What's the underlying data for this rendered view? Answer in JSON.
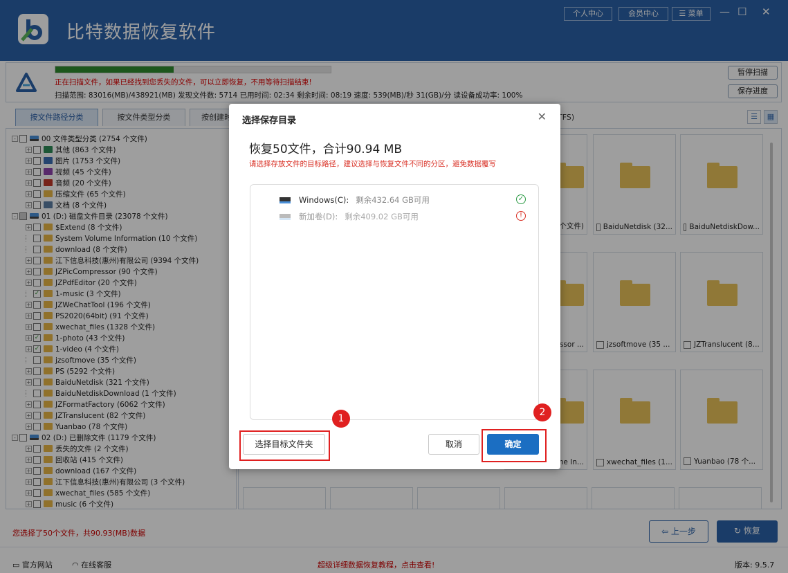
{
  "app": {
    "title": "比特数据恢复软件",
    "personal_center": "个人中心",
    "vip_center": "会员中心",
    "menu": "菜单",
    "minimize": "—",
    "maximize": "☐",
    "close": "✕"
  },
  "scan": {
    "progress": 0.43,
    "message": "正在扫描文件，如果已经找到您丢失的文件，可以立即恢复，不用等待扫描结束!",
    "stats": "扫描范围: 83016(MB)/438921(MB)   发现文件数: 5714   已用时间: 02:34   剩余时间: 08:19   速度: 539(MB)/秒  31(GB)/分   读设备成功率: 100%",
    "pause": "暂停扫描",
    "save_progress": "保存进度"
  },
  "tabs": [
    "按文件路径分类",
    "按文件类型分类",
    "按创建时"
  ],
  "tab_suffix": "TFS)",
  "tree": [
    {
      "t": "00 文件类型分类   (2754 个文件)",
      "ind": 0,
      "exp": "-",
      "icon": "hdd"
    },
    {
      "t": "其他    (863 个文件)",
      "ind": 1,
      "exp": "+",
      "icon": "other"
    },
    {
      "t": "图片    (1753 个文件)",
      "ind": 1,
      "exp": "+",
      "icon": "pic"
    },
    {
      "t": "视频    (45 个文件)",
      "ind": 1,
      "exp": "+",
      "icon": "video"
    },
    {
      "t": "音频    (20 个文件)",
      "ind": 1,
      "exp": "+",
      "icon": "audio"
    },
    {
      "t": "压缩文件   (65 个文件)",
      "ind": 1,
      "exp": "+",
      "icon": "zip"
    },
    {
      "t": "文档    (8 个文件)",
      "ind": 1,
      "exp": "+",
      "icon": "doc"
    },
    {
      "t": "01 (D:) 磁盘文件目录  (23078 个文件)",
      "ind": 0,
      "exp": "-",
      "icon": "hdd",
      "part": true
    },
    {
      "t": "$Extend    (8 个文件)",
      "ind": 1,
      "exp": "+",
      "icon": "folder"
    },
    {
      "t": "System Volume Information    (10 个文件)",
      "ind": 1,
      "exp": "",
      "icon": "folder"
    },
    {
      "t": "download    (8 个文件)",
      "ind": 1,
      "exp": "",
      "icon": "folder"
    },
    {
      "t": "江下信息科技(惠州)有限公司    (9394 个文件)",
      "ind": 1,
      "exp": "+",
      "icon": "folder"
    },
    {
      "t": "JZPicCompressor    (90 个文件)",
      "ind": 1,
      "exp": "+",
      "icon": "folder"
    },
    {
      "t": "JZPdfEditor    (20 个文件)",
      "ind": 1,
      "exp": "+",
      "icon": "folder"
    },
    {
      "t": "1-music    (3 个文件)",
      "ind": 1,
      "exp": "",
      "icon": "folder",
      "checked": true
    },
    {
      "t": "JZWeChatTool    (196 个文件)",
      "ind": 1,
      "exp": "+",
      "icon": "folder"
    },
    {
      "t": "PS2020(64bit)    (91 个文件)",
      "ind": 1,
      "exp": "+",
      "icon": "folder"
    },
    {
      "t": "xwechat_files    (1328 个文件)",
      "ind": 1,
      "exp": "+",
      "icon": "folder"
    },
    {
      "t": "1-photo    (43 个文件)",
      "ind": 1,
      "exp": "+",
      "icon": "folder",
      "checked": true
    },
    {
      "t": "1-video    (4 个文件)",
      "ind": 1,
      "exp": "+",
      "icon": "folder",
      "checked": true
    },
    {
      "t": "jzsoftmove    (35 个文件)",
      "ind": 1,
      "exp": "",
      "icon": "folder"
    },
    {
      "t": "PS    (5292 个文件)",
      "ind": 1,
      "exp": "+",
      "icon": "folder"
    },
    {
      "t": "BaiduNetdisk    (321 个文件)",
      "ind": 1,
      "exp": "+",
      "icon": "folder"
    },
    {
      "t": "BaiduNetdiskDownload    (1 个文件)",
      "ind": 1,
      "exp": "",
      "icon": "folder"
    },
    {
      "t": "JZFormatFactory    (6062 个文件)",
      "ind": 1,
      "exp": "+",
      "icon": "folder"
    },
    {
      "t": "JZTranslucent    (82 个文件)",
      "ind": 1,
      "exp": "+",
      "icon": "folder"
    },
    {
      "t": "Yuanbao    (78 个文件)",
      "ind": 1,
      "exp": "+",
      "icon": "folder"
    },
    {
      "t": "02 (D:) 已删除文件  (1179 个文件)",
      "ind": 0,
      "exp": "-",
      "icon": "hdd"
    },
    {
      "t": "丢失的文件    (2 个文件)",
      "ind": 1,
      "exp": "+",
      "icon": "folder"
    },
    {
      "t": "回收站    (415 个文件)",
      "ind": 1,
      "exp": "+",
      "icon": "folder"
    },
    {
      "t": "download    (167 个文件)",
      "ind": 1,
      "exp": "+",
      "icon": "folder"
    },
    {
      "t": "江下信息科技(惠州)有限公司    (3 个文件)",
      "ind": 1,
      "exp": "+",
      "icon": "folder"
    },
    {
      "t": "xwechat_files    (585 个文件)",
      "ind": 1,
      "exp": "+",
      "icon": "folder"
    },
    {
      "t": "music    (6 个文件)",
      "ind": 1,
      "exp": "+",
      "icon": "folder"
    }
  ],
  "grid": [
    {
      "row": 0,
      "col": 0,
      "label": "个文件)",
      "partial": true
    },
    {
      "row": 0,
      "col": 1,
      "label": "BaiduNetdisk (32..."
    },
    {
      "row": 0,
      "col": 2,
      "label": "BaiduNetdiskDow..."
    },
    {
      "row": 1,
      "col": 0,
      "label": "essor ...",
      "partial": true
    },
    {
      "row": 1,
      "col": 1,
      "label": "jzsoftmove (35 ..."
    },
    {
      "row": 1,
      "col": 2,
      "label": "JZTranslucent (8..."
    },
    {
      "row": 2,
      "col": 0,
      "label": "me In...",
      "partial": true
    },
    {
      "row": 2,
      "col": 1,
      "label": "xwechat_files (1..."
    },
    {
      "row": 2,
      "col": 2,
      "label": "Yuanbao (78 个..."
    }
  ],
  "status": {
    "selected": "您选择了50个文件，共90.93(MB)数据",
    "prev": "上一步",
    "recover": "恢复"
  },
  "footer": {
    "website": "官方网站",
    "service": "在线客服",
    "tutorial": "超级详细数据恢复教程，点击查看!",
    "version": "版本: 9.5.7"
  },
  "dialog": {
    "title": "选择保存目录",
    "headline": "恢复50文件，合计90.94 MB",
    "hint": "请选择存放文件的目标路径，建议选择与恢复文件不同的分区，避免数据覆写",
    "drives": [
      {
        "name": "Windows(C):",
        "free": "剩余432.64 GB可用",
        "status": "ok"
      },
      {
        "name": "新加卷(D):",
        "free": "剩余409.02 GB可用",
        "status": "warn"
      }
    ],
    "choose": "选择目标文件夹",
    "cancel": "取消",
    "ok": "确定",
    "marker1": "1",
    "marker2": "2"
  }
}
